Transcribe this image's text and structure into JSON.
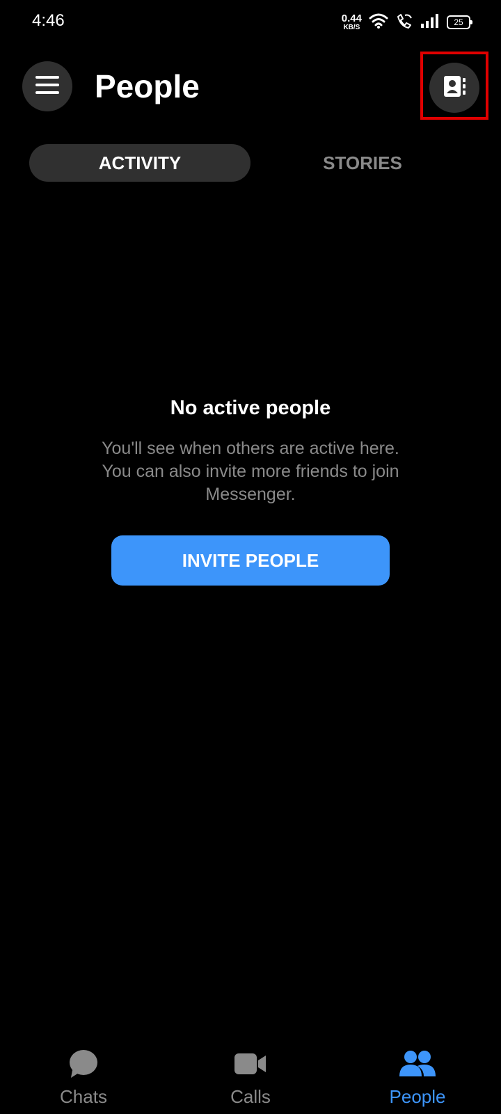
{
  "status_bar": {
    "time": "4:46",
    "net_speed_value": "0.44",
    "net_speed_unit": "KB/S",
    "battery": "25",
    "icons": [
      "wifi-icon",
      "wifi-calling-icon",
      "cell-signal-icon",
      "battery-icon"
    ]
  },
  "header": {
    "title": "People",
    "menu_icon": "hamburger-menu-icon",
    "contacts_icon": "contacts-book-icon"
  },
  "tabs": [
    {
      "label": "ACTIVITY",
      "selected": true
    },
    {
      "label": "STORIES",
      "selected": false
    }
  ],
  "empty_state": {
    "title": "No active people",
    "body": "You'll see when others are active here. You can also invite more friends to join Messenger.",
    "button_label": "INVITE PEOPLE"
  },
  "bottom_nav": {
    "items": [
      {
        "label": "Chats",
        "icon": "chat-bubble-icon",
        "active": false
      },
      {
        "label": "Calls",
        "icon": "video-camera-icon",
        "active": false
      },
      {
        "label": "People",
        "icon": "people-icon",
        "active": true
      }
    ]
  },
  "colors": {
    "background": "#000000",
    "accent": "#3d95fa",
    "surface": "#303030",
    "muted_text": "#8a8a8a",
    "highlight": "#e00000"
  }
}
